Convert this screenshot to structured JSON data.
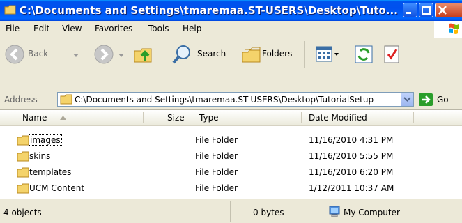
{
  "window": {
    "title": "C:\\Documents and Settings\\tmaremaa.ST-USERS\\Desktop\\Tuto..."
  },
  "menu": [
    "File",
    "Edit",
    "View",
    "Favorites",
    "Tools",
    "Help"
  ],
  "toolbar": {
    "back": "Back",
    "search": "Search",
    "folders": "Folders"
  },
  "address": {
    "label": "Address",
    "value": "C:\\Documents and Settings\\tmaremaa.ST-USERS\\Desktop\\TutorialSetup",
    "go": "Go"
  },
  "columns": {
    "name": "Name",
    "size": "Size",
    "type": "Type",
    "date": "Date Modified"
  },
  "rows": [
    {
      "name": "images",
      "size": "",
      "type": "File Folder",
      "date": "11/16/2010 4:31 PM"
    },
    {
      "name": "skins",
      "size": "",
      "type": "File Folder",
      "date": "11/16/2010 5:55 PM"
    },
    {
      "name": "templates",
      "size": "",
      "type": "File Folder",
      "date": "11/16/2010 6:20 PM"
    },
    {
      "name": "UCM Content",
      "size": "",
      "type": "File Folder",
      "date": "1/12/2011 10:37 AM"
    }
  ],
  "status": {
    "objects": "4 objects",
    "bytes": "0 bytes",
    "location": "My Computer"
  },
  "colors": {
    "titlebar": "#0058ee",
    "folder": "#f4d36b"
  }
}
